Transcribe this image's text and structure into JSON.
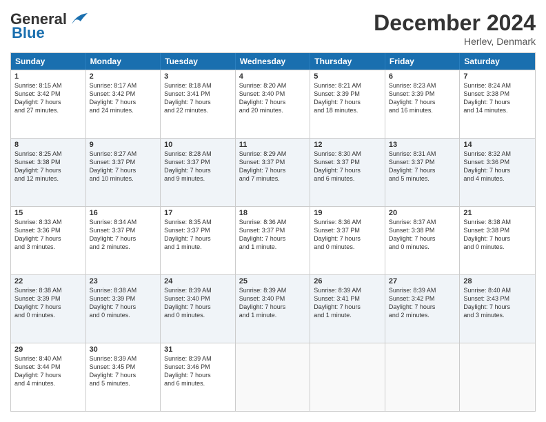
{
  "header": {
    "logo_line1": "General",
    "logo_line2": "Blue",
    "month": "December 2024",
    "location": "Herlev, Denmark"
  },
  "days": [
    "Sunday",
    "Monday",
    "Tuesday",
    "Wednesday",
    "Thursday",
    "Friday",
    "Saturday"
  ],
  "rows": [
    [
      {
        "day": "1",
        "text": "Sunrise: 8:15 AM\nSunset: 3:42 PM\nDaylight: 7 hours\nand 27 minutes."
      },
      {
        "day": "2",
        "text": "Sunrise: 8:17 AM\nSunset: 3:42 PM\nDaylight: 7 hours\nand 24 minutes."
      },
      {
        "day": "3",
        "text": "Sunrise: 8:18 AM\nSunset: 3:41 PM\nDaylight: 7 hours\nand 22 minutes."
      },
      {
        "day": "4",
        "text": "Sunrise: 8:20 AM\nSunset: 3:40 PM\nDaylight: 7 hours\nand 20 minutes."
      },
      {
        "day": "5",
        "text": "Sunrise: 8:21 AM\nSunset: 3:39 PM\nDaylight: 7 hours\nand 18 minutes."
      },
      {
        "day": "6",
        "text": "Sunrise: 8:23 AM\nSunset: 3:39 PM\nDaylight: 7 hours\nand 16 minutes."
      },
      {
        "day": "7",
        "text": "Sunrise: 8:24 AM\nSunset: 3:38 PM\nDaylight: 7 hours\nand 14 minutes."
      }
    ],
    [
      {
        "day": "8",
        "text": "Sunrise: 8:25 AM\nSunset: 3:38 PM\nDaylight: 7 hours\nand 12 minutes."
      },
      {
        "day": "9",
        "text": "Sunrise: 8:27 AM\nSunset: 3:37 PM\nDaylight: 7 hours\nand 10 minutes."
      },
      {
        "day": "10",
        "text": "Sunrise: 8:28 AM\nSunset: 3:37 PM\nDaylight: 7 hours\nand 9 minutes."
      },
      {
        "day": "11",
        "text": "Sunrise: 8:29 AM\nSunset: 3:37 PM\nDaylight: 7 hours\nand 7 minutes."
      },
      {
        "day": "12",
        "text": "Sunrise: 8:30 AM\nSunset: 3:37 PM\nDaylight: 7 hours\nand 6 minutes."
      },
      {
        "day": "13",
        "text": "Sunrise: 8:31 AM\nSunset: 3:37 PM\nDaylight: 7 hours\nand 5 minutes."
      },
      {
        "day": "14",
        "text": "Sunrise: 8:32 AM\nSunset: 3:36 PM\nDaylight: 7 hours\nand 4 minutes."
      }
    ],
    [
      {
        "day": "15",
        "text": "Sunrise: 8:33 AM\nSunset: 3:36 PM\nDaylight: 7 hours\nand 3 minutes."
      },
      {
        "day": "16",
        "text": "Sunrise: 8:34 AM\nSunset: 3:37 PM\nDaylight: 7 hours\nand 2 minutes."
      },
      {
        "day": "17",
        "text": "Sunrise: 8:35 AM\nSunset: 3:37 PM\nDaylight: 7 hours\nand 1 minute."
      },
      {
        "day": "18",
        "text": "Sunrise: 8:36 AM\nSunset: 3:37 PM\nDaylight: 7 hours\nand 1 minute."
      },
      {
        "day": "19",
        "text": "Sunrise: 8:36 AM\nSunset: 3:37 PM\nDaylight: 7 hours\nand 0 minutes."
      },
      {
        "day": "20",
        "text": "Sunrise: 8:37 AM\nSunset: 3:38 PM\nDaylight: 7 hours\nand 0 minutes."
      },
      {
        "day": "21",
        "text": "Sunrise: 8:38 AM\nSunset: 3:38 PM\nDaylight: 7 hours\nand 0 minutes."
      }
    ],
    [
      {
        "day": "22",
        "text": "Sunrise: 8:38 AM\nSunset: 3:39 PM\nDaylight: 7 hours\nand 0 minutes."
      },
      {
        "day": "23",
        "text": "Sunrise: 8:38 AM\nSunset: 3:39 PM\nDaylight: 7 hours\nand 0 minutes."
      },
      {
        "day": "24",
        "text": "Sunrise: 8:39 AM\nSunset: 3:40 PM\nDaylight: 7 hours\nand 0 minutes."
      },
      {
        "day": "25",
        "text": "Sunrise: 8:39 AM\nSunset: 3:40 PM\nDaylight: 7 hours\nand 1 minute."
      },
      {
        "day": "26",
        "text": "Sunrise: 8:39 AM\nSunset: 3:41 PM\nDaylight: 7 hours\nand 1 minute."
      },
      {
        "day": "27",
        "text": "Sunrise: 8:39 AM\nSunset: 3:42 PM\nDaylight: 7 hours\nand 2 minutes."
      },
      {
        "day": "28",
        "text": "Sunrise: 8:40 AM\nSunset: 3:43 PM\nDaylight: 7 hours\nand 3 minutes."
      }
    ],
    [
      {
        "day": "29",
        "text": "Sunrise: 8:40 AM\nSunset: 3:44 PM\nDaylight: 7 hours\nand 4 minutes."
      },
      {
        "day": "30",
        "text": "Sunrise: 8:39 AM\nSunset: 3:45 PM\nDaylight: 7 hours\nand 5 minutes."
      },
      {
        "day": "31",
        "text": "Sunrise: 8:39 AM\nSunset: 3:46 PM\nDaylight: 7 hours\nand 6 minutes."
      },
      {
        "day": "",
        "text": ""
      },
      {
        "day": "",
        "text": ""
      },
      {
        "day": "",
        "text": ""
      },
      {
        "day": "",
        "text": ""
      }
    ]
  ]
}
